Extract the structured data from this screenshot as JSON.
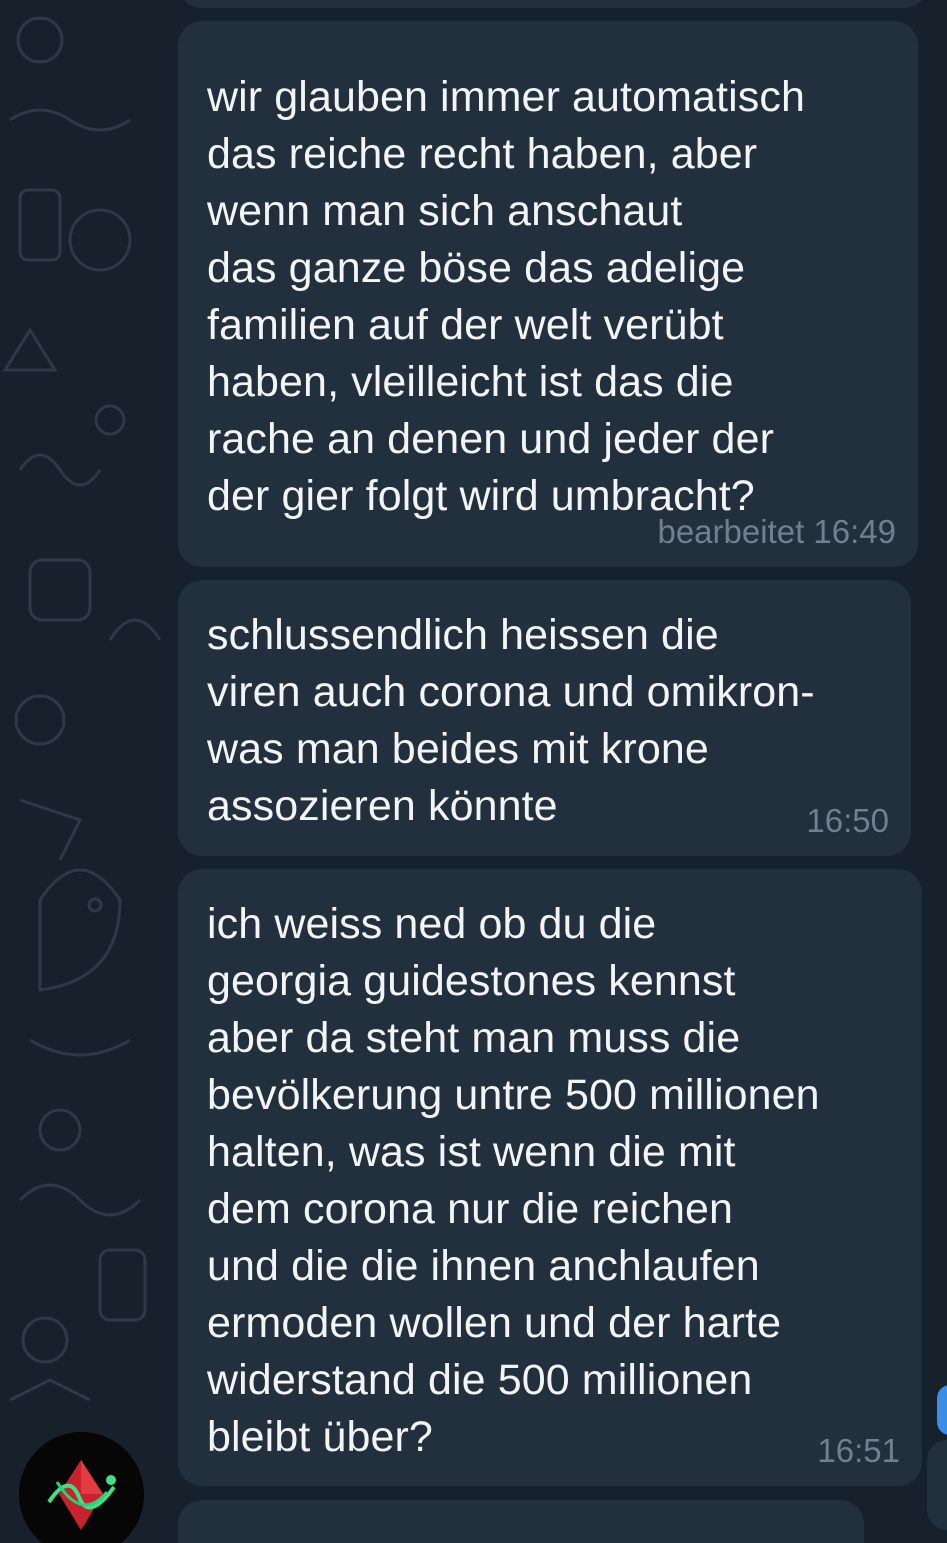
{
  "messages": [
    {
      "text": "wir glauben immer automatisch\ndas reiche recht haben, aber\nwenn man sich anschaut\ndas ganze böse das adelige\nfamilien auf der welt verübt\nhaben, vleilleicht ist das die\nrache an denen und jeder der\nder gier folgt wird umbracht?",
      "time": "bearbeitet 16:49"
    },
    {
      "text": "schlussendlich heissen die\nviren auch corona und omikron-\nwas man beides mit krone\nassozieren könnte",
      "time": "16:50"
    },
    {
      "text": "ich weiss ned ob du die\ngeorgia guidestones kennst\naber da steht man muss die\nbevölkerung untre 500 millionen\nhalten, was ist wenn die mit\ndem corona nur die reichen\nund die die ihnen anchlaufen\nermoden wollen und der harte\nwiderstand die 500 millionen\nbleibt über?",
      "time": "16:51"
    }
  ],
  "colors": {
    "background": "#17212b",
    "bubble": "#222f3d",
    "text": "#f2f4f6",
    "timestamp": "#6f808f",
    "badge": "#3a8ee6"
  },
  "icons": {
    "avatar": "avatar-image",
    "background": "doodle-pattern"
  }
}
